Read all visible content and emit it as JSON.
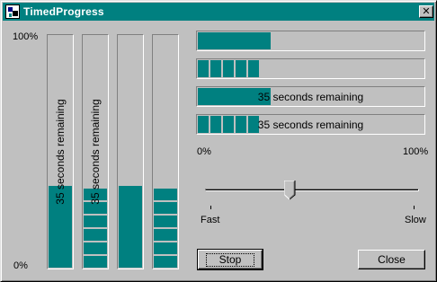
{
  "window": {
    "title": "TimedProgress",
    "close_glyph": "✕",
    "icon": "app-icon"
  },
  "labels": {
    "vertical_max": "100%",
    "vertical_min": "0%",
    "horizontal_min": "0%",
    "horizontal_max": "100%",
    "slider_min": "Fast",
    "slider_max": "Slow"
  },
  "progress": {
    "vertical": [
      {
        "style": "smooth",
        "value": 0.35,
        "text": "35 seconds remaining"
      },
      {
        "style": "segmented",
        "value": 0.35,
        "text": "35 seconds remaining"
      },
      {
        "style": "smooth",
        "value": 0.35,
        "text": ""
      },
      {
        "style": "segmented",
        "value": 0.35,
        "text": ""
      }
    ],
    "horizontal": [
      {
        "style": "smooth",
        "value": 0.32,
        "text": ""
      },
      {
        "style": "segmented",
        "value": 0.32,
        "text": ""
      },
      {
        "style": "smooth",
        "value": 0.32,
        "text": "35 seconds remaining"
      },
      {
        "style": "segmented",
        "value": 0.32,
        "text": "35 seconds remaining"
      }
    ]
  },
  "slider": {
    "value": 0.39
  },
  "buttons": {
    "stop_label": "Stop",
    "close_label": "Close"
  },
  "colors": {
    "accent": "#008080",
    "face": "#c0c0c0"
  }
}
